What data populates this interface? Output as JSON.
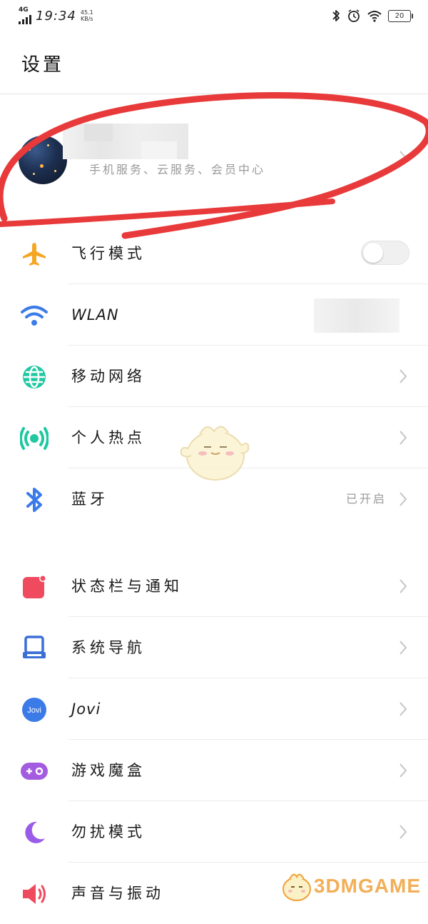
{
  "status_bar": {
    "network": "4G",
    "time": "19:34",
    "speed": "45.1",
    "speed_unit": "KB/s",
    "battery": "20",
    "icons": [
      "bluetooth-icon",
      "alarm-icon",
      "wifi-icon",
      "battery-icon"
    ]
  },
  "header": {
    "title": "设置"
  },
  "account": {
    "subtitle": "手机服务、云服务、会员中心"
  },
  "group1": [
    {
      "id": "airplane",
      "label": "飞行模式",
      "icon": "airplane-icon",
      "color": "#f5a623",
      "control": "toggle",
      "toggle_on": false
    },
    {
      "id": "wlan",
      "label": "WLAN",
      "icon": "wifi-icon",
      "color": "#3b7be8",
      "control": "blurred"
    },
    {
      "id": "mobile",
      "label": "移动网络",
      "icon": "globe-icon",
      "color": "#1fc8a0",
      "control": "chevron"
    },
    {
      "id": "hotspot",
      "label": "个人热点",
      "icon": "hotspot-icon",
      "color": "#1fc8a0",
      "control": "chevron"
    },
    {
      "id": "bluetooth",
      "label": "蓝牙",
      "icon": "bluetooth-icon",
      "color": "#3b7be8",
      "control": "chevron",
      "value": "已开启"
    }
  ],
  "group2": [
    {
      "id": "statusbar",
      "label": "状态栏与通知",
      "icon": "notification-icon",
      "color": "#f04a5e"
    },
    {
      "id": "navigation",
      "label": "系统导航",
      "icon": "navigation-icon",
      "color": "#3b6fd8"
    },
    {
      "id": "jovi",
      "label": "Jovi",
      "icon": "jovi-icon",
      "color": "#3b7be8",
      "icon_text": "Jovi"
    },
    {
      "id": "gamebox",
      "label": "游戏魔盒",
      "icon": "gamepad-icon",
      "color": "#a35ce0"
    },
    {
      "id": "dnd",
      "label": "勿扰模式",
      "icon": "moon-icon",
      "color": "#9a5ce8"
    },
    {
      "id": "sound",
      "label": "声音与振动",
      "icon": "speaker-icon",
      "color": "#f04a5e"
    }
  ],
  "watermark": {
    "text": "3DMGAME"
  }
}
